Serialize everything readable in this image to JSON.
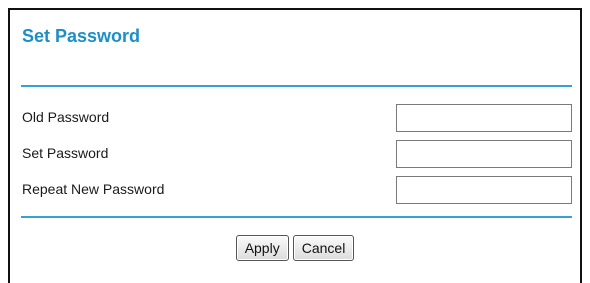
{
  "page": {
    "title": "Set Password"
  },
  "fields": [
    {
      "label": "Old Password",
      "value": "",
      "placeholder": ""
    },
    {
      "label": "Set Password",
      "value": "",
      "placeholder": ""
    },
    {
      "label": "Repeat New Password",
      "value": "",
      "placeholder": ""
    }
  ],
  "buttons": {
    "apply_label": "Apply",
    "cancel_label": "Cancel"
  },
  "colors": {
    "title": "#1c8ec9",
    "rule": "#3a9fd6"
  }
}
